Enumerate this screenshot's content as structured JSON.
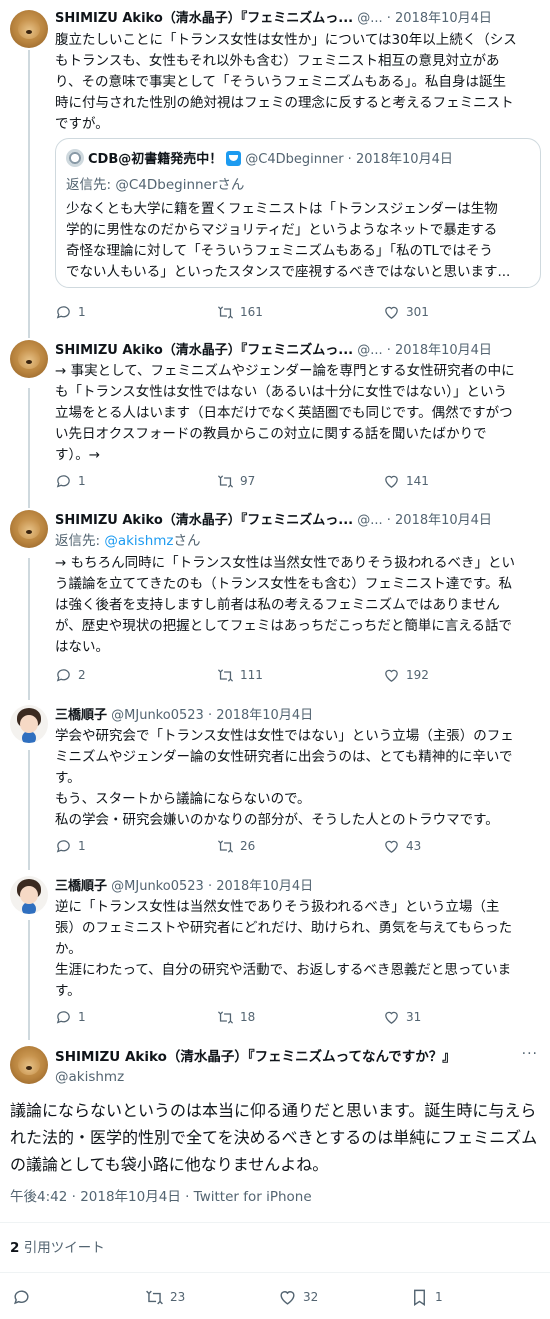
{
  "tweets": [
    {
      "name": "SHIMIZU Akiko（清水晶子）『フェミニズムっ...",
      "handle": "@...",
      "date": "· 2018年10月4日",
      "lines": [
        "腹立たしいことに「トランス女性は女性か」については30年以上続く（シス",
        "もトランスも、女性もそれ以外も含む）フェミニスト相互の意見対立があ",
        "り、その意味で事実として「そういうフェミニズムもある」。私自身は誕生",
        "時に付与された性別の絶対視はフェミの理念に反すると考えるフェミニスト",
        "ですが。"
      ],
      "quote": {
        "name": "CDB@初書籍発売中！",
        "handle": "@C4Dbeginner · 2018年10月4日",
        "reply_prefix": "返信先: ",
        "reply_link": "@C4Dbeginnerさん",
        "lines": [
          "少なくとも大学に籍を置くフェミニストは「トランスジェンダーは生物",
          "学的に男性なのだからマジョリティだ」というようなネットで暴走する",
          "奇怪な理論に対して「そういうフェミニズムもある」「私のTLではそう",
          "でない人もいる」といったスタンスで座視するべきではないと思います..."
        ]
      },
      "replies": "1",
      "retweets": "161",
      "likes": "301"
    },
    {
      "name": "SHIMIZU Akiko（清水晶子）『フェミニズムっ...",
      "handle": "@...",
      "date": "· 2018年10月4日",
      "lines": [
        "→ 事実として、フェミニズムやジェンダー論を専門とする女性研究者の中に",
        "も「トランス女性は女性ではない（あるいは十分に女性ではない）」という",
        "立場をとる人はいます（日本だけでなく英語圏でも同じです。偶然ですがつ",
        "い先日オクスフォードの教員からこの対立に関する話を聞いたばかりで",
        "す）。→"
      ],
      "replies": "1",
      "retweets": "97",
      "likes": "141"
    },
    {
      "name": "SHIMIZU Akiko（清水晶子）『フェミニズムっ...",
      "handle": "@...",
      "date": "· 2018年10月4日",
      "reply_prefix": "返信先: ",
      "reply_link": "@akishmz",
      "reply_suffix": "さん",
      "lines": [
        "→ もちろん同時に「トランス女性は当然女性でありそう扱われるべき」とい",
        "う議論を立ててきたのも（トランス女性をも含む）フェミニスト達です。私",
        "は強く後者を支持しますし前者は私の考えるフェミニズムではありません",
        "が、歴史や現状の把握としてフェミはあっちだこっちだと簡単に言える話で",
        "はない。"
      ],
      "replies": "2",
      "retweets": "111",
      "likes": "192"
    },
    {
      "name": "三橋順子",
      "handle": "@MJunko0523",
      "date": "· 2018年10月4日",
      "lines": [
        "学会や研究会で「トランス女性は女性ではない」という立場（主張）のフェ",
        "ミニズムやジェンダー論の女性研究者に出会うのは、とても精神的に辛いで",
        "す。",
        "もう、スタートから議論にならないので。",
        "私の学会・研究会嫌いのかなりの部分が、そうした人とのトラウマです。"
      ],
      "replies": "1",
      "retweets": "26",
      "likes": "43"
    },
    {
      "name": "三橋順子",
      "handle": "@MJunko0523",
      "date": "· 2018年10月4日",
      "lines": [
        "逆に「トランス女性は当然女性でありそう扱われるべき」という立場（主",
        "張）のフェミニストや研究者にどれだけ、助けられ、勇気を与えてもらった",
        "か。",
        "生涯にわたって、自分の研究や活動で、お返しするべき恩義だと思っていま",
        "す。"
      ],
      "replies": "1",
      "retweets": "18",
      "likes": "31"
    }
  ],
  "main": {
    "name": "SHIMIZU Akiko（清水晶子）『フェミニズムってなんですか？』",
    "handle": "@akishmz",
    "lines": [
      "議論にならないというのは本当に仰る通りだと思います。誕生時に与えら",
      "れた法的・医学的性別で全てを決めるべきとするのは単純にフェミニズム",
      "の議論としても袋小路に他なりませんよね。"
    ],
    "meta": "午後4:42 · 2018年10月4日 · Twitter for iPhone",
    "quote_count": "2",
    "quote_label": " 引用ツイート",
    "retweets": "23",
    "likes": "32",
    "bookmarks": "1"
  },
  "icons": [
    "reply-icon",
    "retweet-icon",
    "like-icon",
    "bookmark-icon",
    "more-icon",
    "verified-icon"
  ],
  "colors": {
    "accent": "#1d9bf0",
    "muted": "#536471",
    "text": "#0f1419",
    "border": "#cfd9de"
  }
}
